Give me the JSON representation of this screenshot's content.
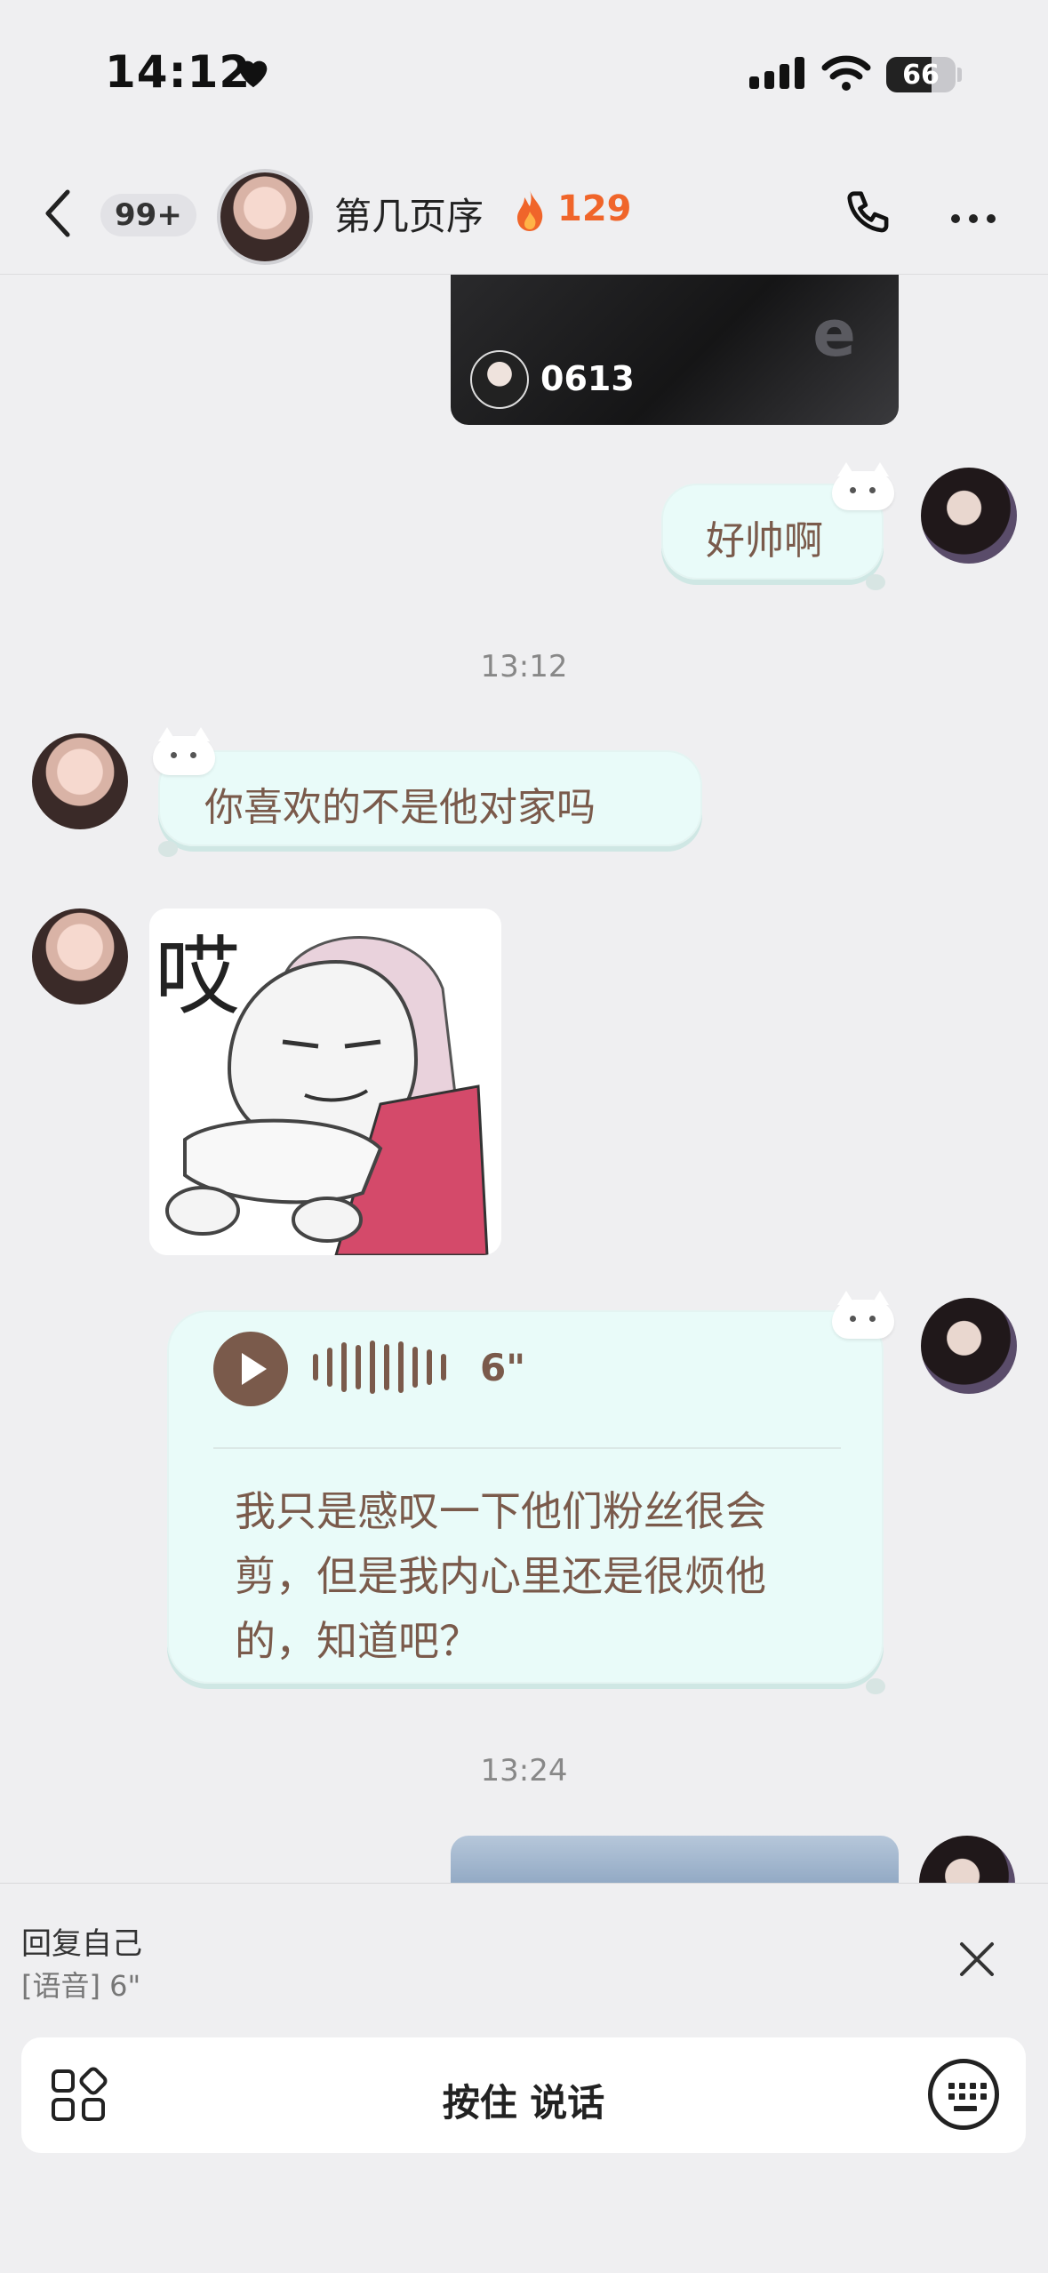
{
  "status_bar": {
    "time": "14:12",
    "battery": "66",
    "battery_level": 0.66
  },
  "header": {
    "unread_count": "99+",
    "contact_name": "第几页序",
    "streak": "129"
  },
  "messages": {
    "video_id": "0613",
    "video_bg_text": "e",
    "msg_sent_1": "好帅啊",
    "timestamp_1": "13:12",
    "msg_recv_1": "你喜欢的不是他对家吗",
    "sticker_text": "哎",
    "voice_duration": "6\"",
    "voice_transcript": "我只是感叹一下他们粉丝很会剪，但是我内心里还是很烦他的，知道吧？",
    "timestamp_2": "13:24"
  },
  "reply": {
    "title": "回复自己",
    "quote": "[语音] 6\""
  },
  "input": {
    "talk_label": "按住 说话"
  },
  "colors": {
    "bubble_bg": "#e9fbf9",
    "bubble_text": "#7a5a4b",
    "streak": "#f0652a",
    "background": "#efeff1"
  }
}
